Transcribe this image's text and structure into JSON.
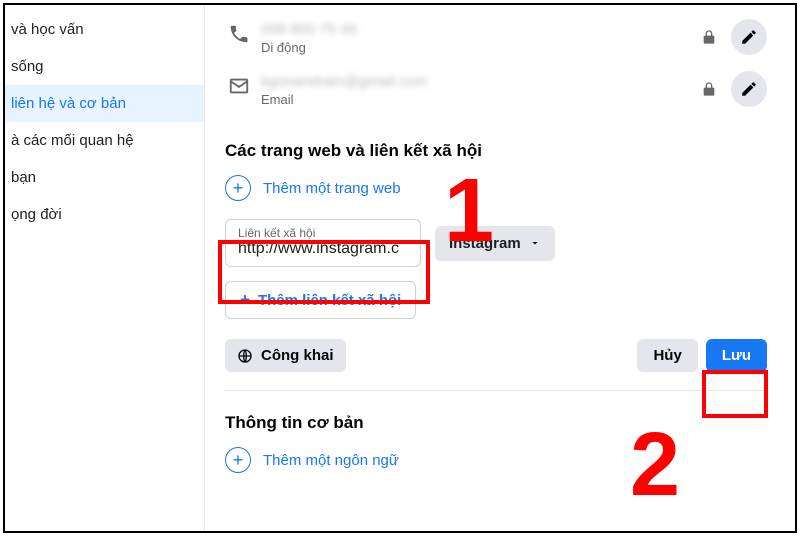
{
  "sidebar": {
    "items": [
      {
        "label": " và học vấn"
      },
      {
        "label": " sống"
      },
      {
        "label": " liên hệ và cơ bản"
      },
      {
        "label": "à các mối quan hệ"
      },
      {
        "label": " bạn"
      },
      {
        "label": "ọng đời"
      }
    ],
    "active_index": 2
  },
  "contact": {
    "phone": {
      "value": "098 800 75 46",
      "type_label": "Di động"
    },
    "email": {
      "value": "kgonandrain@gmail.com",
      "type_label": "Email"
    }
  },
  "websites": {
    "heading": "Các trang web và liên kết xã hội",
    "add_website_label": "Thêm một trang web",
    "social_input": {
      "float_label": "Liên kết xã hội",
      "value": "http://www.instagram.c"
    },
    "platform_dropdown": "Instagram",
    "add_social_label": "Thêm liên kết xã hội"
  },
  "actions": {
    "audience_label": "Công khai",
    "cancel_label": "Hủy",
    "save_label": "Lưu"
  },
  "basic": {
    "heading": "Thông tin cơ bản",
    "add_language_label": "Thêm một ngôn ngữ"
  },
  "annotations": {
    "num1": "1",
    "num2": "2"
  }
}
